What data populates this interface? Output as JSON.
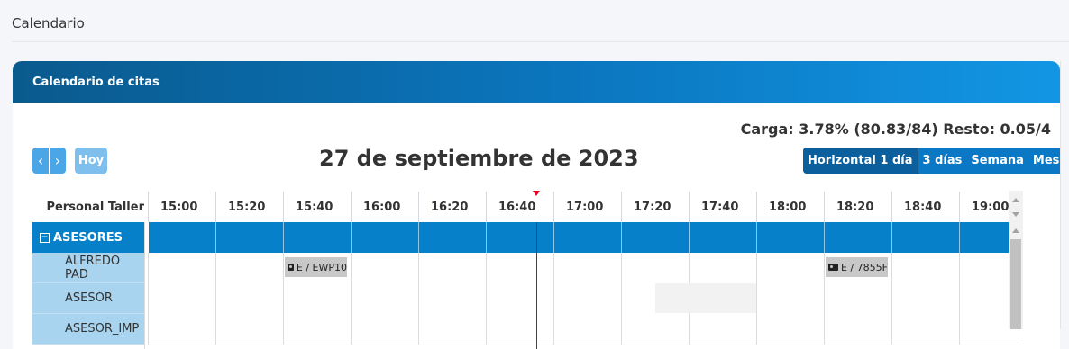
{
  "page": {
    "title": "Calendario"
  },
  "card": {
    "title": "Calendario de citas"
  },
  "summary": {
    "carga": "Carga: 3.78% (80.83/84) Resto: 0.05/4"
  },
  "toolbar": {
    "prev_icon": "‹",
    "next_icon": "›",
    "today_label": "Hoy",
    "date_title": "27 de septiembre de 2023",
    "views": [
      "Horizontal 1 día",
      "3 días",
      "Semana",
      "Mes"
    ],
    "active_view": "Horizontal 1 día"
  },
  "grid": {
    "resource_header": "Personal Taller",
    "times": [
      "15:00",
      "15:20",
      "15:40",
      "16:00",
      "16:20",
      "16:40",
      "17:00",
      "17:20",
      "17:40",
      "18:00",
      "18:20",
      "18:40",
      "19:00"
    ],
    "current_time_marker": "16:55",
    "group": {
      "toggle": "−",
      "label": "ASESORES"
    },
    "rows": [
      {
        "name": "ALFREDO PAD"
      },
      {
        "name": "ASESOR"
      },
      {
        "name": "ASESOR_IMP"
      }
    ],
    "events": [
      {
        "row": 0,
        "start": "15:40",
        "end": "16:00",
        "label": "E / EWP10",
        "icon": "id-card-icon"
      },
      {
        "row": 0,
        "start": "18:20",
        "end": "18:40",
        "label": "E / 7855F",
        "icon": "id-card-icon"
      }
    ],
    "blocked": [
      {
        "row": 1,
        "start": "17:30",
        "end": "18:00"
      }
    ]
  },
  "colors": {
    "header_gradient_start": "#0a5a8d",
    "header_gradient_end": "#1296e4",
    "group_row": "#0680c8",
    "resource_cell": "#a9d4ef",
    "now_line": "#d0021b"
  }
}
